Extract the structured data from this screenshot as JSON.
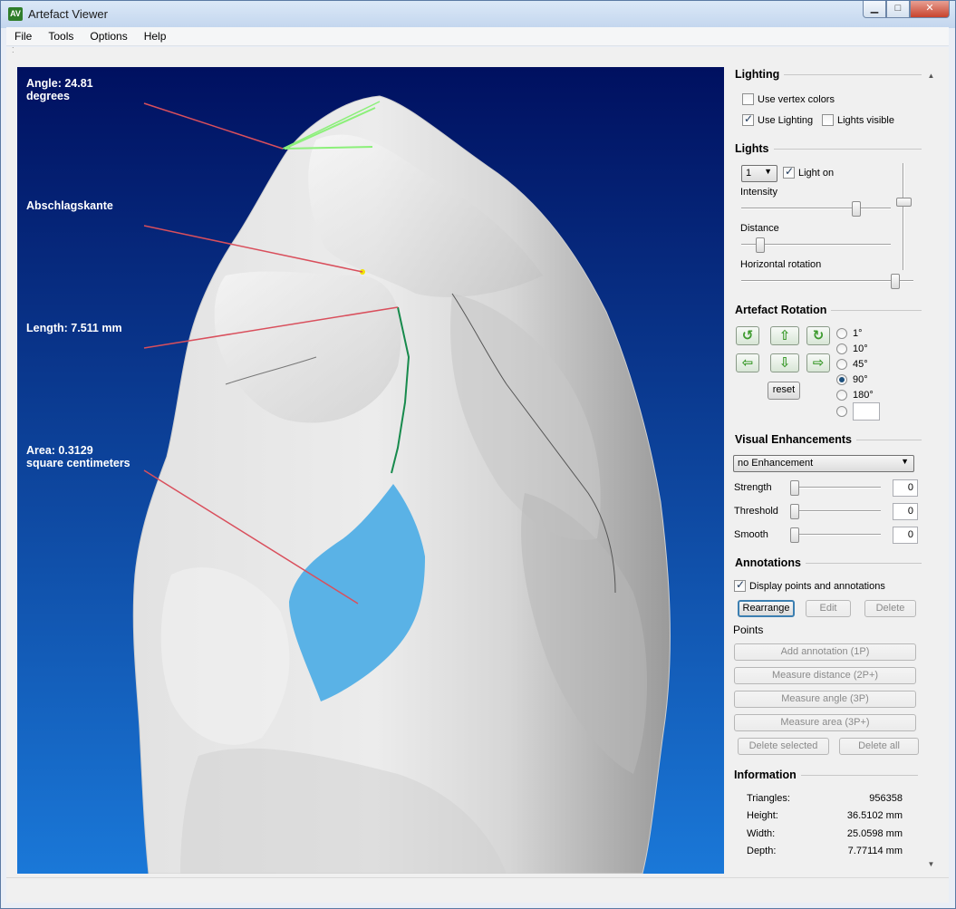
{
  "window": {
    "title": "Artefact Viewer",
    "icon_text": "AV",
    "min_glyph": "▁",
    "max_glyph": "□",
    "close_glyph": "✕"
  },
  "menu": [
    "File",
    "Tools",
    "Options",
    "Help"
  ],
  "viewport": {
    "annotations": {
      "angle": "Angle: 24.81\ndegrees",
      "edge": "Abschlagskante",
      "length": "Length: 7.511 mm",
      "area": "Area: 0.3129\nsquare centimeters"
    },
    "colors": {
      "bg_top": "#001060",
      "bg_bottom": "#1a78d8",
      "leader_line": "#d94f5c",
      "area_fill": "#5ab2e6",
      "angle_line": "#8cf07a",
      "length_line": "#178a4c"
    }
  },
  "panel": {
    "lighting": {
      "title": "Lighting",
      "use_vertex_colors": "Use vertex colors",
      "use_lighting": "Use Lighting",
      "lights_visible": "Lights visible"
    },
    "lights": {
      "title": "Lights",
      "light_select": "1",
      "light_on": "Light on",
      "intensity": "Intensity",
      "distance": "Distance",
      "horizontal_rotation": "Horizontal rotation"
    },
    "rotation": {
      "title": "Artefact Rotation",
      "reset": "reset",
      "steps": [
        "1°",
        "10°",
        "45°",
        "90°",
        "180°"
      ],
      "selected_step": "90°",
      "custom_step": ""
    },
    "enhancements": {
      "title": "Visual Enhancements",
      "mode": "no Enhancement",
      "strength_label": "Strength",
      "strength": "0",
      "threshold_label": "Threshold",
      "threshold": "0",
      "smooth_label": "Smooth",
      "smooth": "0"
    },
    "annotations": {
      "title": "Annotations",
      "display": "Display points and annotations",
      "rearrange": "Rearrange",
      "edit": "Edit",
      "delete": "Delete",
      "points_label": "Points",
      "add_annotation": "Add annotation (1P)",
      "measure_distance": "Measure distance (2P+)",
      "measure_angle": "Measure angle (3P)",
      "measure_area": "Measure area (3P+)",
      "delete_selected": "Delete selected",
      "delete_all": "Delete all"
    },
    "information": {
      "title": "Information",
      "rows": [
        {
          "key": "Triangles:",
          "value": "956358"
        },
        {
          "key": "Height:",
          "value": "36.5102 mm"
        },
        {
          "key": "Width:",
          "value": "25.0598 mm"
        },
        {
          "key": "Depth:",
          "value": "7.77114 mm"
        }
      ]
    }
  }
}
